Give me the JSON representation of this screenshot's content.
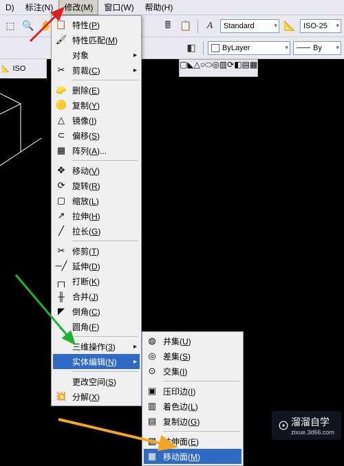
{
  "menubar": [
    {
      "label": "D)"
    },
    {
      "label": "标注(N)"
    },
    {
      "label": "修改(M)",
      "active": true
    },
    {
      "label": "窗口(W)"
    },
    {
      "label": "帮助(H)"
    }
  ],
  "toolbar1": {
    "textstyle_combo": "Standard",
    "dimstyle_combo": "ISO-25"
  },
  "toolbar2": {
    "layer_combo": "ByLayer",
    "color_combo": "By"
  },
  "vtool_label": "ISO",
  "modify_menu": [
    {
      "icon": "📋",
      "label": "特性(P)"
    },
    {
      "icon": "🖌",
      "label": "特性匹配(M)"
    },
    {
      "icon": "",
      "label": "对象",
      "sub": true
    },
    {
      "icon": "✂",
      "label": "剪裁(C)",
      "sub": true
    },
    {
      "sep": true
    },
    {
      "icon": "🧽",
      "label": "删除(E)"
    },
    {
      "icon": "🟡",
      "label": "复制(Y)"
    },
    {
      "icon": "△",
      "label": "镜像(I)"
    },
    {
      "icon": "⊂",
      "label": "偏移(S)"
    },
    {
      "icon": "▦",
      "label": "阵列(A)..."
    },
    {
      "sep": true
    },
    {
      "icon": "✥",
      "label": "移动(V)"
    },
    {
      "icon": "⟳",
      "label": "旋转(R)"
    },
    {
      "icon": "▢",
      "label": "缩放(L)"
    },
    {
      "icon": "↗",
      "label": "拉伸(H)"
    },
    {
      "icon": "╱",
      "label": "拉长(G)"
    },
    {
      "sep": true
    },
    {
      "icon": "✂",
      "label": "修剪(T)"
    },
    {
      "icon": "─╱",
      "label": "延伸(D)"
    },
    {
      "icon": "┌┐",
      "label": "打断(K)"
    },
    {
      "icon": "╫",
      "label": "合并(J)"
    },
    {
      "icon": "◤",
      "label": "倒角(C)"
    },
    {
      "icon": "◟",
      "label": "圆角(F)"
    },
    {
      "sep": true
    },
    {
      "icon": "",
      "label": "三维操作(3)",
      "sub": true
    },
    {
      "icon": "",
      "label": "实体编辑(N)",
      "sub": true,
      "highlight": true
    },
    {
      "sep": true
    },
    {
      "icon": "",
      "label": "更改空间(S)"
    },
    {
      "icon": "💥",
      "label": "分解(X)"
    }
  ],
  "solid_edit_submenu": [
    {
      "icon": "◍",
      "label": "并集(U)"
    },
    {
      "icon": "◎",
      "label": "差集(S)"
    },
    {
      "icon": "⊙",
      "label": "交集(I)"
    },
    {
      "sep": true
    },
    {
      "icon": "▣",
      "label": "压印边(I)"
    },
    {
      "icon": "▥",
      "label": "着色边(L)"
    },
    {
      "icon": "▤",
      "label": "复制边(G)"
    },
    {
      "sep": true
    },
    {
      "icon": "▧",
      "label": "拉伸面(E)"
    },
    {
      "icon": "▦",
      "label": "移动面(M)",
      "highlight": true
    }
  ],
  "watermark": {
    "main": "溜溜自学",
    "sub": "zixue.3d66.com"
  }
}
